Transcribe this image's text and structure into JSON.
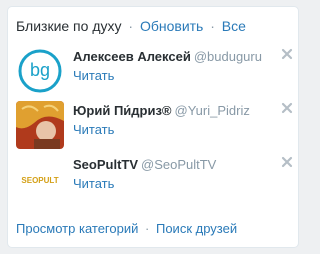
{
  "header": {
    "title": "Близкие по духу",
    "separator": "·",
    "refresh_label": "Обновить",
    "all_label": "Все"
  },
  "suggestions": [
    {
      "name": "Алексеев Алексей",
      "handle": "@buduguru",
      "follow_label": "Читать",
      "avatar_text": "bg",
      "avatar_color": "#1aa1c9"
    },
    {
      "name": "Юрий Пи́дриз®",
      "handle": "@Yuri_Pidriz",
      "follow_label": "Читать",
      "avatar_color": "#c0392b"
    },
    {
      "name": "SeoPultTV",
      "handle": "@SeoPultTV",
      "follow_label": "Читать",
      "avatar_text": "SEOPULT",
      "avatar_color": "#d4a017"
    }
  ],
  "footer": {
    "categories_label": "Просмотр категорий",
    "separator": "·",
    "find_friends_label": "Поиск друзей"
  },
  "icons": {
    "dismiss": "close-icon"
  }
}
